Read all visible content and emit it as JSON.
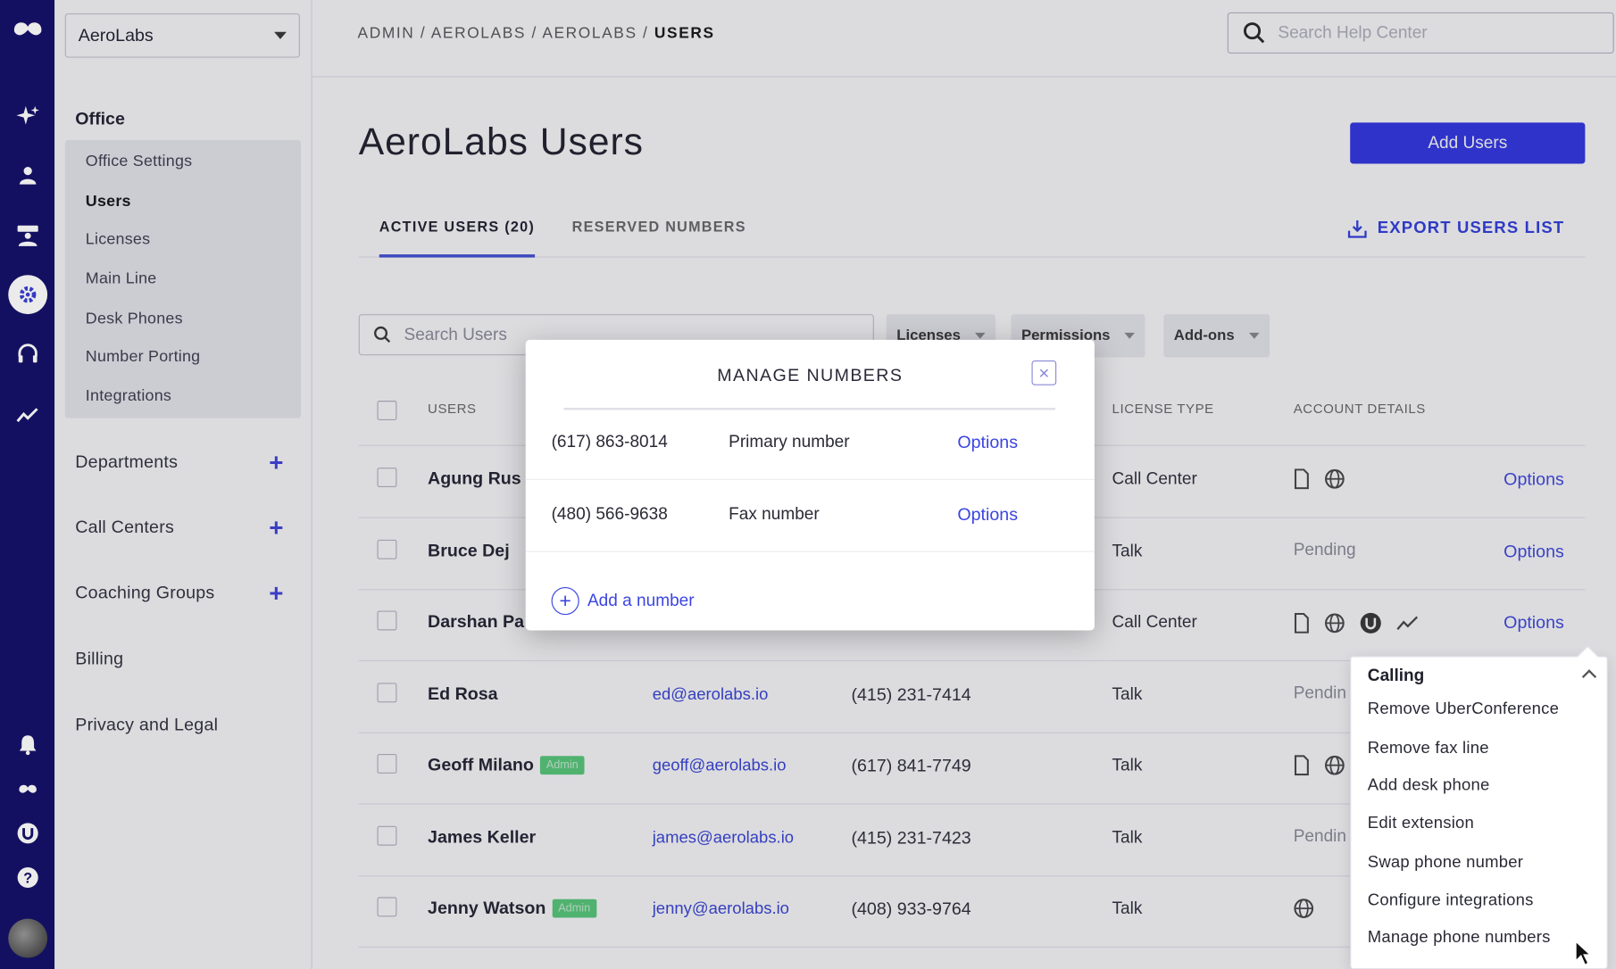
{
  "account": {
    "name": "AeroLabs"
  },
  "sidebar": {
    "office_heading": "Office",
    "office_items": [
      {
        "label": "Office Settings"
      },
      {
        "label": "Users"
      },
      {
        "label": "Licenses"
      },
      {
        "label": "Main Line"
      },
      {
        "label": "Desk Phones"
      },
      {
        "label": "Number Porting"
      },
      {
        "label": "Integrations"
      }
    ],
    "sections": [
      {
        "label": "Departments"
      },
      {
        "label": "Call Centers"
      },
      {
        "label": "Coaching Groups"
      },
      {
        "label": "Billing"
      },
      {
        "label": "Privacy and Legal"
      }
    ]
  },
  "breadcrumb": {
    "parts": "ADMIN / AEROLABS / AEROLABS / ",
    "current": "USERS"
  },
  "help_search": {
    "placeholder": "Search Help Center"
  },
  "page": {
    "title": "AeroLabs Users",
    "add_button": "Add Users"
  },
  "tabs": [
    {
      "label": "ACTIVE USERS (20)"
    },
    {
      "label": "RESERVED NUMBERS"
    }
  ],
  "export_label": "EXPORT USERS LIST",
  "user_search": {
    "placeholder": "Search Users"
  },
  "filters": [
    {
      "label": "Licenses"
    },
    {
      "label": "Permissions"
    },
    {
      "label": "Add-ons"
    }
  ],
  "table": {
    "headers": {
      "users": "USERS",
      "license": "LICENSE TYPE",
      "account": "ACCOUNT DETAILS"
    },
    "rows": [
      {
        "name": "Agung Rus",
        "badge": "",
        "email": "",
        "phone": "",
        "license": "Call Center",
        "details": "",
        "options": "Options"
      },
      {
        "name": "Bruce Dej",
        "badge": "",
        "email": "",
        "phone": "",
        "license": "Talk",
        "details": "Pending",
        "options": "Options"
      },
      {
        "name": "Darshan Pa",
        "badge": "",
        "email": "",
        "phone": "",
        "license": "Call Center",
        "details": "",
        "options": "Options"
      },
      {
        "name": "Ed Rosa",
        "badge": "",
        "email": "ed@aerolabs.io",
        "phone": "(415) 231-7414",
        "license": "Talk",
        "details": "Pendin",
        "options": ""
      },
      {
        "name": "Geoff Milano",
        "badge": "Admin",
        "email": "geoff@aerolabs.io",
        "phone": "(617) 841-7749",
        "license": "Talk",
        "details": "",
        "options": ""
      },
      {
        "name": "James Keller",
        "badge": "",
        "email": "james@aerolabs.io",
        "phone": "(415) 231-7423",
        "license": "Talk",
        "details": "Pendin",
        "options": ""
      },
      {
        "name": "Jenny Watson",
        "badge": "Admin",
        "email": "jenny@aerolabs.io",
        "phone": "(408) 933-9764",
        "license": "Talk",
        "details": "",
        "options": ""
      }
    ]
  },
  "modal": {
    "title": "MANAGE NUMBERS",
    "numbers": [
      {
        "number": "(617) 863-8014",
        "type": "Primary number",
        "options": "Options"
      },
      {
        "number": "(480) 566-9638",
        "type": "Fax number",
        "options": "Options"
      }
    ],
    "add_label": "Add a number"
  },
  "dropdown": {
    "heading": "Calling",
    "items": [
      {
        "label": "Remove UberConference"
      },
      {
        "label": "Remove fax line"
      },
      {
        "label": "Add desk phone"
      },
      {
        "label": "Edit extension"
      },
      {
        "label": "Swap phone number"
      },
      {
        "label": "Configure integrations"
      },
      {
        "label": "Manage phone numbers"
      }
    ]
  },
  "colors": {
    "rail": "#16126a",
    "accent": "#2c31e6",
    "link": "#3b45e0",
    "admin_badge": "#55cc77"
  }
}
